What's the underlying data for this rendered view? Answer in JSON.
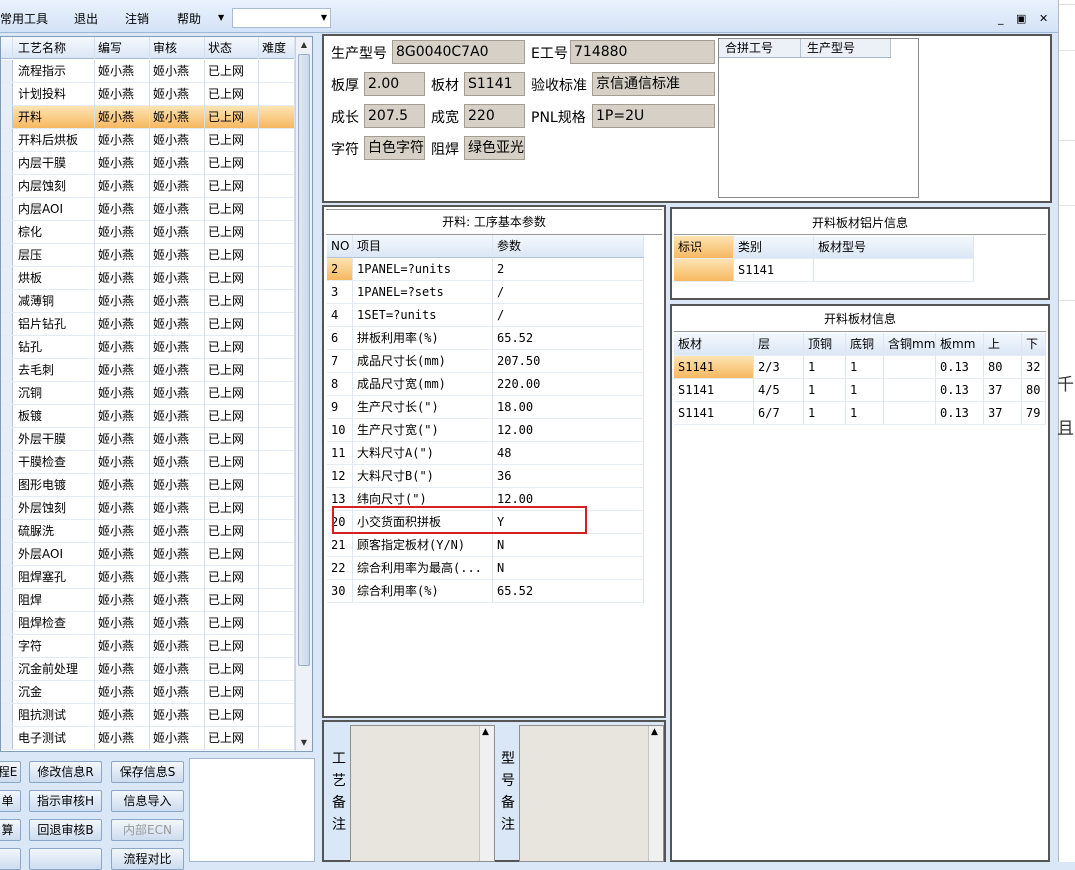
{
  "menu": {
    "tools": "常用工具",
    "exit": "退出",
    "logout": "注销",
    "help": "帮助",
    "combo_value": "",
    "win_min": "_",
    "win_restore": "▣",
    "win_close": "✕"
  },
  "process_grid": {
    "headers": [
      "工艺名称",
      "编写",
      "审核",
      "状态",
      "难度"
    ],
    "selected_index": 2,
    "rows": [
      [
        "流程指示",
        "姬小燕",
        "姬小燕",
        "已上网",
        ""
      ],
      [
        "计划投料",
        "姬小燕",
        "姬小燕",
        "已上网",
        ""
      ],
      [
        "开料",
        "姬小燕",
        "姬小燕",
        "已上网",
        ""
      ],
      [
        "开料后烘板",
        "姬小燕",
        "姬小燕",
        "已上网",
        ""
      ],
      [
        "内层干膜",
        "姬小燕",
        "姬小燕",
        "已上网",
        ""
      ],
      [
        "内层蚀刻",
        "姬小燕",
        "姬小燕",
        "已上网",
        ""
      ],
      [
        "内层AOI",
        "姬小燕",
        "姬小燕",
        "已上网",
        ""
      ],
      [
        "棕化",
        "姬小燕",
        "姬小燕",
        "已上网",
        ""
      ],
      [
        "层压",
        "姬小燕",
        "姬小燕",
        "已上网",
        ""
      ],
      [
        "烘板",
        "姬小燕",
        "姬小燕",
        "已上网",
        ""
      ],
      [
        "减薄铜",
        "姬小燕",
        "姬小燕",
        "已上网",
        ""
      ],
      [
        "铝片钻孔",
        "姬小燕",
        "姬小燕",
        "已上网",
        ""
      ],
      [
        "钻孔",
        "姬小燕",
        "姬小燕",
        "已上网",
        ""
      ],
      [
        "去毛刺",
        "姬小燕",
        "姬小燕",
        "已上网",
        ""
      ],
      [
        "沉铜",
        "姬小燕",
        "姬小燕",
        "已上网",
        ""
      ],
      [
        "板镀",
        "姬小燕",
        "姬小燕",
        "已上网",
        ""
      ],
      [
        "外层干膜",
        "姬小燕",
        "姬小燕",
        "已上网",
        ""
      ],
      [
        "干膜检查",
        "姬小燕",
        "姬小燕",
        "已上网",
        ""
      ],
      [
        "图形电镀",
        "姬小燕",
        "姬小燕",
        "已上网",
        ""
      ],
      [
        "外层蚀刻",
        "姬小燕",
        "姬小燕",
        "已上网",
        ""
      ],
      [
        "硫脲洗",
        "姬小燕",
        "姬小燕",
        "已上网",
        ""
      ],
      [
        "外层AOI",
        "姬小燕",
        "姬小燕",
        "已上网",
        ""
      ],
      [
        "阻焊塞孔",
        "姬小燕",
        "姬小燕",
        "已上网",
        ""
      ],
      [
        "阻焊",
        "姬小燕",
        "姬小燕",
        "已上网",
        ""
      ],
      [
        "阻焊检查",
        "姬小燕",
        "姬小燕",
        "已上网",
        ""
      ],
      [
        "字符",
        "姬小燕",
        "姬小燕",
        "已上网",
        ""
      ],
      [
        "沉金前处理",
        "姬小燕",
        "姬小燕",
        "已上网",
        ""
      ],
      [
        "沉金",
        "姬小燕",
        "姬小燕",
        "已上网",
        ""
      ],
      [
        "阻抗测试",
        "姬小燕",
        "姬小燕",
        "已上网",
        ""
      ],
      [
        "电子测试",
        "姬小燕",
        "姬小燕",
        "已上网",
        ""
      ]
    ]
  },
  "buttons": {
    "b1": "程E",
    "b2": "修改信息R",
    "b3": "保存信息S",
    "b4": "单",
    "b5": "指示审核H",
    "b6": "信息导入",
    "b7": "算",
    "b8": "回退审核B",
    "b9": "内部ECN",
    "b10": "",
    "b11": "",
    "b12": "流程对比"
  },
  "header": {
    "model_label": "生产型号",
    "model_value": "8G0040C7A0",
    "eno_label": "E工号",
    "eno_value": "714880",
    "thick_label": "板厚",
    "thick_value": "2.00",
    "material_label": "板材",
    "material_value": "S1141",
    "std_label": "验收标准",
    "std_value": "京信通信标准",
    "len_label": "成长",
    "len_value": "207.5",
    "wid_label": "成宽",
    "wid_value": "220",
    "pnl_label": "PNL规格",
    "pnl_value": "1P=2U",
    "char_label": "字符",
    "char_value": "白色字符",
    "mask_label": "阻焊",
    "mask_value": "绿色亚光",
    "merge_headers": [
      "合拼工号",
      "生产型号"
    ]
  },
  "params": {
    "title": "开料: 工序基本参数",
    "headers": [
      "NO",
      "项目",
      "参数"
    ],
    "rows": [
      [
        "2",
        "1PANEL=?units",
        "2"
      ],
      [
        "3",
        "1PANEL=?sets",
        "/"
      ],
      [
        "4",
        "1SET=?units",
        "/"
      ],
      [
        "6",
        "拼板利用率(%)",
        "65.52"
      ],
      [
        "7",
        "成品尺寸长(mm)",
        "207.50"
      ],
      [
        "8",
        "成品尺寸宽(mm)",
        "220.00"
      ],
      [
        "9",
        "生产尺寸长(\")",
        "18.00"
      ],
      [
        "10",
        "生产尺寸宽(\")",
        "12.00"
      ],
      [
        "11",
        "大料尺寸A(\")",
        "48"
      ],
      [
        "12",
        "大料尺寸B(\")",
        "36"
      ],
      [
        "13",
        "纬向尺寸(\")",
        "12.00"
      ],
      [
        "20",
        "小交货面积拼板",
        "Y"
      ],
      [
        "21",
        "顾客指定板材(Y/N)",
        "N"
      ],
      [
        "22",
        "综合利用率为最高(...",
        "N"
      ],
      [
        "30",
        "综合利用率(%)",
        "65.52"
      ]
    ]
  },
  "remarks": {
    "process_label": "工艺备注",
    "model_label": "型号备注"
  },
  "al_sheet": {
    "title": "开料板材铝片信息",
    "headers": [
      "标识",
      "类别",
      "板材型号"
    ],
    "rows": [
      [
        "",
        "S1141",
        ""
      ]
    ]
  },
  "board_info": {
    "title": "开料板材信息",
    "headers": [
      "板材",
      "层",
      "顶铜",
      "底铜",
      "含铜mm",
      "板mm",
      "上",
      "下"
    ],
    "rows": [
      [
        "S1141",
        "2/3",
        "1",
        "1",
        "",
        "0.13",
        "80",
        "32"
      ],
      [
        "S1141",
        "4/5",
        "1",
        "1",
        "",
        "0.13",
        "37",
        "80"
      ],
      [
        "S1141",
        "6/7",
        "1",
        "1",
        "",
        "0.13",
        "37",
        "79"
      ]
    ]
  },
  "side_glyphs": [
    "千",
    "且"
  ]
}
